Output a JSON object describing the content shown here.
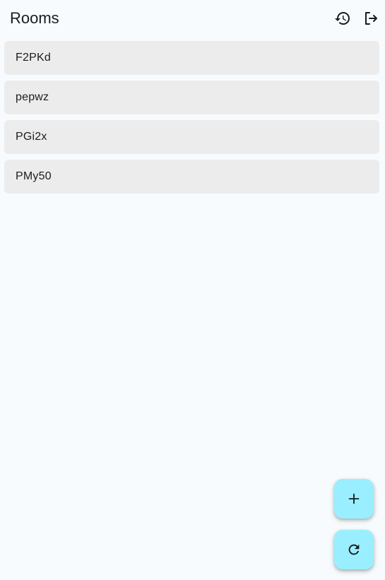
{
  "header": {
    "title": "Rooms",
    "history_icon": "history-icon",
    "logout_icon": "logout-icon"
  },
  "rooms": [
    {
      "name": "F2PKd"
    },
    {
      "name": "pepwz"
    },
    {
      "name": "PGi2x"
    },
    {
      "name": "PMy50"
    }
  ],
  "fabs": {
    "add_icon": "plus-icon",
    "refresh_icon": "refresh-icon"
  },
  "colors": {
    "background": "#f7fbfd",
    "list_item": "#ececec",
    "fab": "#99efff",
    "text": "#1a1c1e"
  }
}
